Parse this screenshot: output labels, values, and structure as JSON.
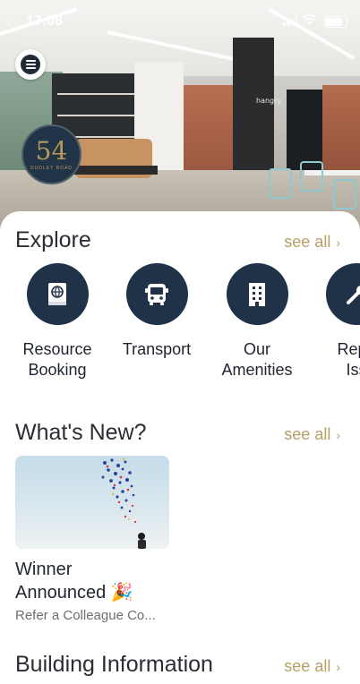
{
  "status_bar": {
    "time": "17:08"
  },
  "hero": {
    "logo_number": "54",
    "logo_subtitle": "DUDLEY ROAD",
    "pillar_text": "hangry"
  },
  "explore": {
    "title": "Explore",
    "see_all": "see all",
    "items": [
      {
        "label_line1": "Resource",
        "label_line2": "Booking",
        "icon": "book-globe-icon"
      },
      {
        "label_line1": "Transport",
        "label_line2": "",
        "icon": "bus-icon"
      },
      {
        "label_line1": "Our",
        "label_line2": "Amenities",
        "icon": "building-icon"
      },
      {
        "label_line1": "Repo",
        "label_line2": "Iss",
        "icon": "wrench-icon"
      }
    ]
  },
  "whats_new": {
    "title": "What's New?",
    "see_all": "see all",
    "card": {
      "title_line1": "Winner",
      "title_line2": "Announced 🎉",
      "subtitle": "Refer a Colleague Co..."
    }
  },
  "building_info": {
    "title": "Building Information",
    "see_all": "see all"
  },
  "colors": {
    "accent_gold": "#b79f67",
    "icon_navy": "#1f3247",
    "text_dark": "#1f2430"
  }
}
